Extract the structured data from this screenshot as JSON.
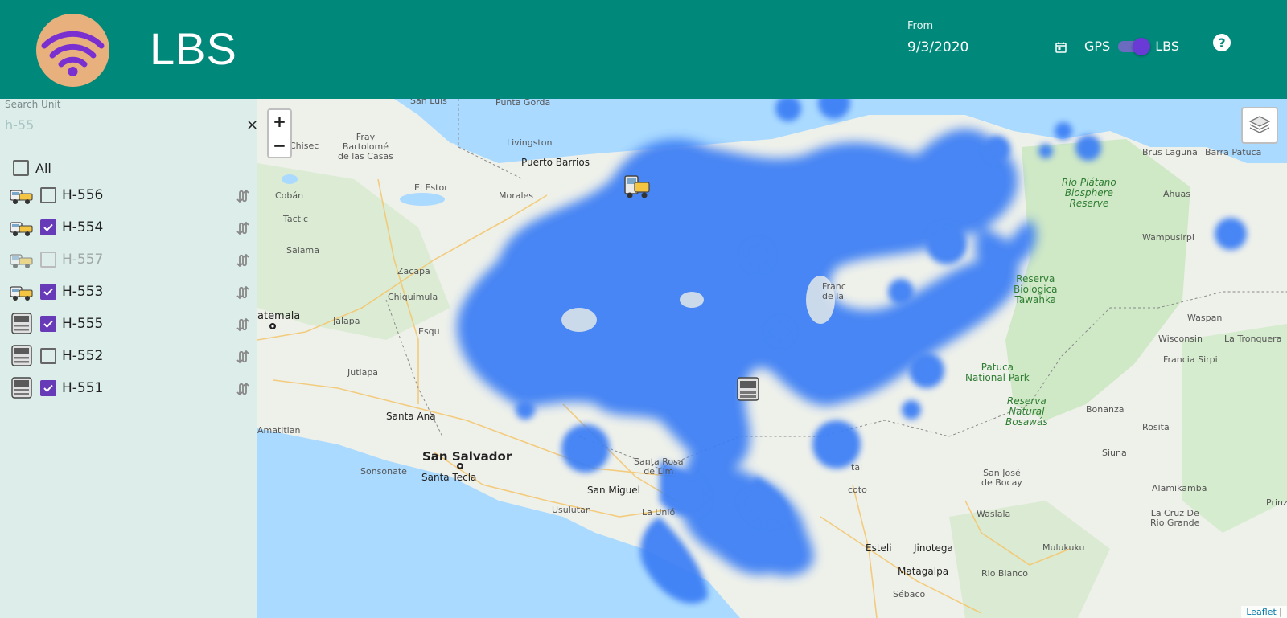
{
  "header": {
    "title": "LBS",
    "date_label": "From",
    "date_value": "9/3/2020",
    "switch_left": "GPS",
    "switch_right": "LBS",
    "help": "?"
  },
  "sidebar": {
    "search_label": "Search Unit",
    "search_value": "h-55",
    "clear": "×",
    "all_label": "All",
    "units": [
      {
        "label": "H-556",
        "checked": false,
        "disabled": false,
        "icon": "tow-truck-icon"
      },
      {
        "label": "H-554",
        "checked": true,
        "disabled": false,
        "icon": "tow-truck-icon"
      },
      {
        "label": "H-557",
        "checked": false,
        "disabled": true,
        "icon": "tow-truck-icon"
      },
      {
        "label": "H-553",
        "checked": true,
        "disabled": false,
        "icon": "tow-truck-icon"
      },
      {
        "label": "H-555",
        "checked": true,
        "disabled": false,
        "icon": "truck-front-icon"
      },
      {
        "label": "H-552",
        "checked": false,
        "disabled": false,
        "icon": "truck-front-icon"
      },
      {
        "label": "H-551",
        "checked": true,
        "disabled": false,
        "icon": "truck-front-icon"
      }
    ]
  },
  "map": {
    "zoom_in": "+",
    "zoom_out": "−",
    "attribution": "Leaflet",
    "attribution_sep": " |",
    "labels": {
      "san_luis": "San Luis",
      "punta_gorda": "Punta Gorda",
      "chisec": "Chisec",
      "fray": "Fray\nBartolomé\nde las Casas",
      "livingston": "Livingston",
      "puerto_barrios": "Puerto Barrios",
      "el_estor": "El Estor",
      "coban": "Cobán",
      "morales": "Morales",
      "tactic": "Tactic",
      "salama": "Salama",
      "zacapa": "Zacapa",
      "chiquimula": "Chiquimula",
      "guatemala": "atemala",
      "jalapa": "Jalapa",
      "esqu": "Esqu",
      "jutiapa": "Jutiapa",
      "santa_ana": "Santa Ana",
      "amatitlan": "Amatitlan",
      "san_salvador": "San Salvador",
      "sonsonate": "Sonsonate",
      "santa_tecla": "Santa Tecla",
      "san_miguel": "San Miguel",
      "usulutan": "Usulutan",
      "la_union": "La Unió",
      "santa_rosa": "Santa Rosa\nde Lim",
      "esteli": "Esteli",
      "jinotega": "Jinotega",
      "matagalpa": "Matagalpa",
      "sebaco": "Sébaco",
      "rio_blanco": "Rio Blanco",
      "mulukuku": "Mulukuku",
      "waslala": "Waslala",
      "san_jose_bocay": "San José\nde Bocay",
      "siuna": "Siuna",
      "alamikamba": "Alamikamba",
      "la_cruz": "La Cruz De\nRio Grande",
      "prinz": "Prinz",
      "rosita": "Rosita",
      "bonanza": "Bonanza",
      "francia_sirpi": "Francia Sirpi",
      "wisconsin": "Wisconsin",
      "la_tronquera": "La Tronquera",
      "waspan": "Waspan",
      "wampusirpi": "Wampusirpi",
      "ahuas": "Ahuas",
      "brus_laguna": "Brus Laguna",
      "barra_patuca": "Barra Patuca",
      "rio_platano": "Río Plátano\nBiosphere\nReserve",
      "tawahka": "Reserva\nBiologica\nTawahka",
      "patuca": "Patuca\nNational Park",
      "bosawas": "Reserva\nNatural\nBosawás",
      "franc": "Franc\nde la",
      "ocoto": "coto",
      "tal": "tal"
    }
  }
}
